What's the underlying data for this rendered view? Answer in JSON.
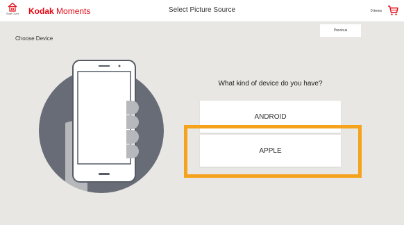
{
  "header": {
    "home_label": "Start Over",
    "brand_bold": "Kodak",
    "brand_light": "Moments",
    "title": "Select Picture Source",
    "items_label": "0 items"
  },
  "page": {
    "section_title": "Choose Device",
    "previous_label": "Previous",
    "question": "What kind of device do you have?",
    "options": [
      {
        "label": "ANDROID"
      },
      {
        "label": "APPLE"
      }
    ]
  },
  "colors": {
    "brand": "#e30613",
    "highlight": "#f5a21c",
    "background": "#e9e7e3",
    "illustration_circle": "#686c77",
    "hand": "#b6b8bc"
  },
  "icons": [
    "home-icon",
    "cart-icon",
    "phone-in-hand-illustration"
  ]
}
